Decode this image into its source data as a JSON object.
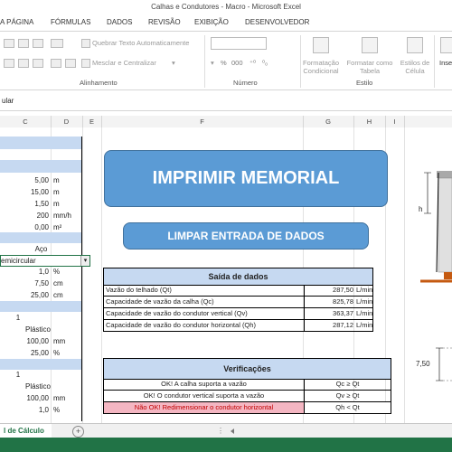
{
  "window": {
    "title": "Calhas e Condutores - Macro - Microsoft Excel"
  },
  "tabs": [
    "A PÁGINA",
    "FÓRMULAS",
    "DADOS",
    "REVISÃO",
    "EXIBIÇÃO",
    "DESENVOLVEDOR"
  ],
  "ribbon": {
    "wrap_text": "Quebrar Texto Automaticamente",
    "merge_center": "Mesclar e Centralizar",
    "alignment_label": "Alinhamento",
    "number_label": "Número",
    "percent": "%",
    "thousands": "000",
    "cond_format": "Formatação Condicional",
    "format_table": "Formatar como Tabela",
    "cell_styles": "Estilos de Célula",
    "styles_label": "Estilo",
    "insert": "Inse"
  },
  "formula_bar": {
    "content": "ular"
  },
  "columns": [
    "C",
    "D",
    "E",
    "F",
    "G",
    "H",
    "I"
  ],
  "inputs": {
    "r1": {
      "value": "5,00",
      "unit": "m"
    },
    "r2": {
      "value": "15,00",
      "unit": "m"
    },
    "r3": {
      "value": "1,50",
      "unit": "m"
    },
    "r4": {
      "value": "200",
      "unit": "mm/h"
    },
    "r5": {
      "value": "0,00",
      "unit": "m²"
    },
    "material": "Aço",
    "shape": "emicircular",
    "r8": {
      "value": "1,0",
      "unit": "%"
    },
    "r9": {
      "value": "7,50",
      "unit": "cm"
    },
    "r10": {
      "value": "25,00",
      "unit": "cm"
    },
    "vert_count": "1",
    "vert_material": "Plástico",
    "r13": {
      "value": "100,00",
      "unit": "mm"
    },
    "r14": {
      "value": "25,00",
      "unit": "%"
    },
    "horiz_count": "1",
    "horiz_material": "Plástico",
    "r17": {
      "value": "100,00",
      "unit": "mm"
    },
    "r18": {
      "value": "1,0",
      "unit": "%"
    }
  },
  "buttons": {
    "print": "IMPRIMIR MEMORIAL",
    "clear": "LIMPAR ENTRADA DE DADOS"
  },
  "output": {
    "title": "Saída de dados",
    "rows": [
      {
        "label": "Vazão do telhado (Qt)",
        "value": "287,50",
        "unit": "L/min"
      },
      {
        "label": "Capacidade de vazão da calha (Qc)",
        "value": "825,78",
        "unit": "L/min"
      },
      {
        "label": "Capacidade de vazão do condutor vertical (Qv)",
        "value": "363,37",
        "unit": "L/min"
      },
      {
        "label": "Capacidade de vazão do condutor horizontal (Qh)",
        "value": "287,12",
        "unit": "L/min"
      }
    ]
  },
  "checks": {
    "title": "Verificações",
    "rows": [
      {
        "msg": "OK! A calha suporta a vazão",
        "cond": "Qc ≥ Qt",
        "status": "ok"
      },
      {
        "msg": "OK! O condutor vertical suporta a vazão",
        "cond": "Qv ≥ Qt",
        "status": "ok"
      },
      {
        "msg": "Não OK! Redimensionar o condutor horizontal",
        "cond": "Qh < Qt",
        "status": "fail"
      }
    ]
  },
  "diagram": {
    "h_label": "h",
    "dim_label": "7,50"
  },
  "sheet_tab": "l de Cálculo",
  "colors": {
    "accent_blue": "#5b9bd5",
    "header_blue": "#c6d9f1",
    "fail_pink": "#f4b6c2",
    "excel_green": "#217346"
  }
}
